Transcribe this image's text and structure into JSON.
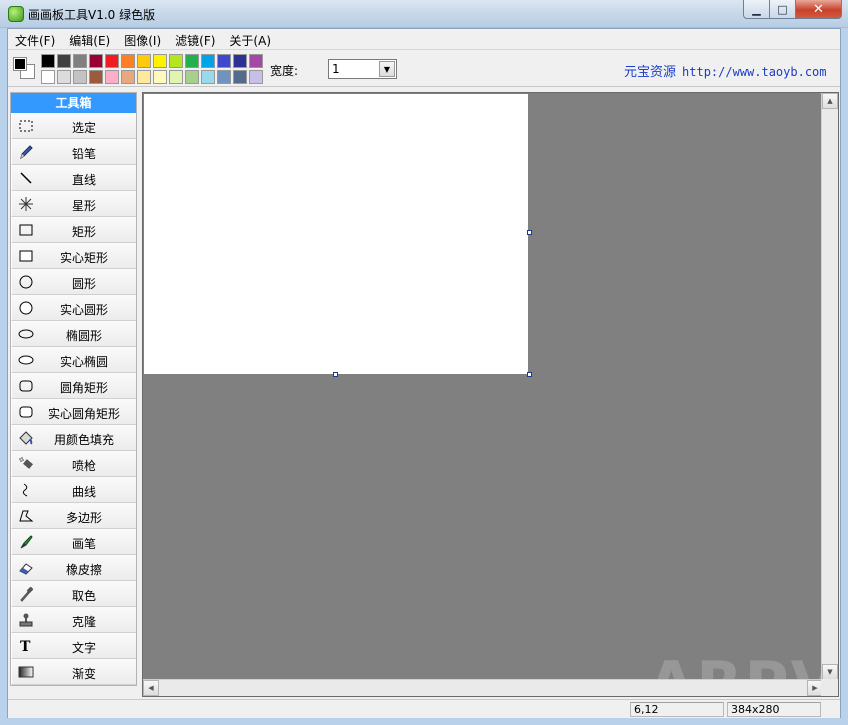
{
  "window": {
    "title": "画画板工具V1.0 绿色版",
    "min_glyph": "▁",
    "max_glyph": "□",
    "close_glyph": "✕"
  },
  "menu": [
    "文件(F)",
    "编辑(E)",
    "图像(I)",
    "滤镜(F)",
    "关于(A)"
  ],
  "toolbar": {
    "foreground_color": "#000000",
    "background_color": "#ffffff",
    "palette_row1": [
      "#000000",
      "#404040",
      "#808080",
      "#990033",
      "#ee1c24",
      "#ff7f27",
      "#ffc90e",
      "#fff200",
      "#b5e61d",
      "#22b14c",
      "#00a2e8",
      "#3f48cc",
      "#2e3192",
      "#a349a4"
    ],
    "palette_row2": [
      "#ffffff",
      "#dcdcdc",
      "#c3c3c3",
      "#9c5a3c",
      "#ffaec9",
      "#e6a87c",
      "#ffe9a0",
      "#fff9bd",
      "#e0f5b0",
      "#a8d08d",
      "#99d9ea",
      "#7092be",
      "#556b8e",
      "#c8bfe7"
    ],
    "width_label": "宽度:",
    "width_value": "1",
    "dropdown_glyph": "▼",
    "brand_name": "元宝资源",
    "brand_url": "http://www.taoyb.com"
  },
  "toolbox": {
    "header": "工具箱",
    "tools": [
      {
        "label": "选定",
        "icon": "select-rect-icon"
      },
      {
        "label": "铅笔",
        "icon": "pencil-icon"
      },
      {
        "label": "直线",
        "icon": "line-icon"
      },
      {
        "label": "星形",
        "icon": "star-icon"
      },
      {
        "label": "矩形",
        "icon": "rectangle-icon"
      },
      {
        "label": "实心矩形",
        "icon": "filled-rectangle-icon"
      },
      {
        "label": "圆形",
        "icon": "circle-icon"
      },
      {
        "label": "实心圆形",
        "icon": "filled-circle-icon"
      },
      {
        "label": "椭圆形",
        "icon": "ellipse-icon"
      },
      {
        "label": "实心椭圆",
        "icon": "filled-ellipse-icon"
      },
      {
        "label": "圆角矩形",
        "icon": "rounded-rectangle-icon"
      },
      {
        "label": "实心圆角矩形",
        "icon": "filled-rounded-rectangle-icon"
      },
      {
        "label": "用颜色填充",
        "icon": "paint-bucket-icon"
      },
      {
        "label": "喷枪",
        "icon": "airbrush-icon"
      },
      {
        "label": "曲线",
        "icon": "curve-icon"
      },
      {
        "label": "多边形",
        "icon": "polygon-icon"
      },
      {
        "label": "画笔",
        "icon": "brush-icon"
      },
      {
        "label": "橡皮擦",
        "icon": "eraser-icon"
      },
      {
        "label": "取色",
        "icon": "color-picker-icon"
      },
      {
        "label": "克隆",
        "icon": "clone-stamp-icon"
      },
      {
        "label": "文字",
        "icon": "text-icon"
      },
      {
        "label": "渐变",
        "icon": "gradient-icon"
      }
    ]
  },
  "canvas": {
    "background_color": "#ffffff",
    "workspace_color": "#808080",
    "watermark": "ARPVIN"
  },
  "scrollbars": {
    "up": "▲",
    "down": "▼",
    "left": "◀",
    "right": "▶"
  },
  "status": {
    "message": "",
    "cursor_position": "6,12",
    "image_size": "384x280"
  }
}
